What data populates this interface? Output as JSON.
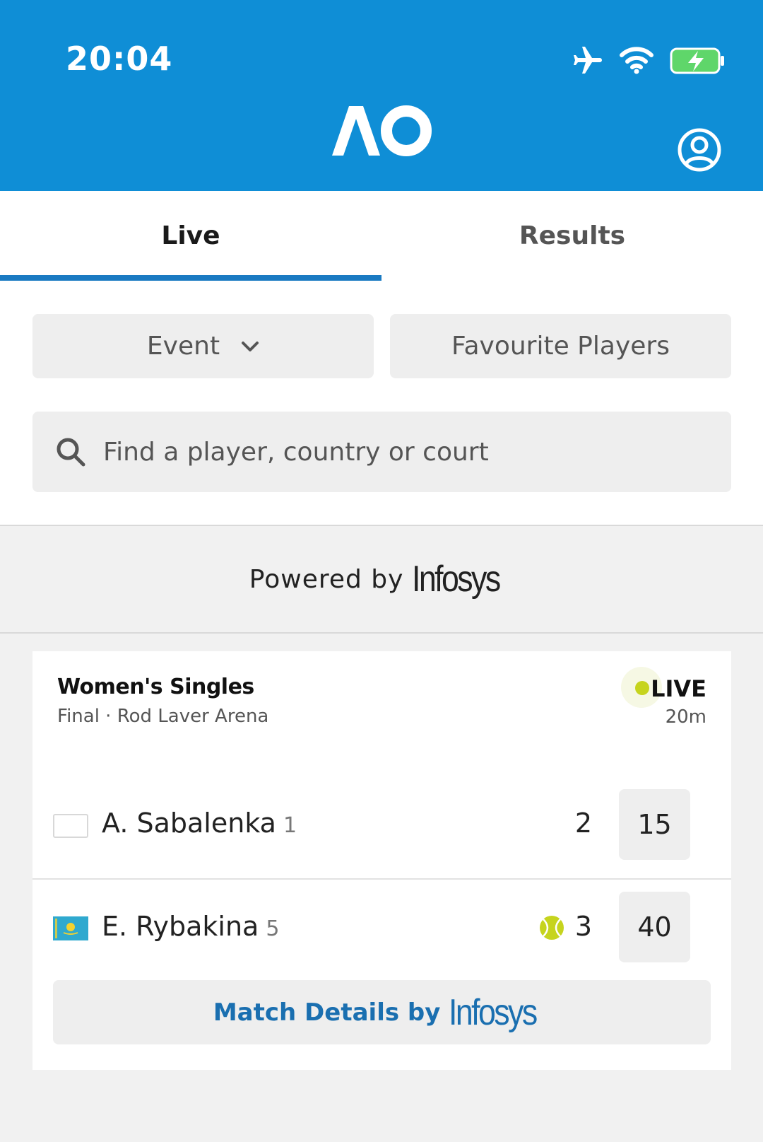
{
  "status_bar": {
    "time": "20:04",
    "icons": [
      "airplane-icon",
      "wifi-icon",
      "battery-charging-icon"
    ]
  },
  "header": {
    "logo_text": "AO",
    "account_icon": "user-circle-icon",
    "background_color": "#0f8ed6"
  },
  "tabs": [
    {
      "label": "Live",
      "active": true
    },
    {
      "label": "Results",
      "active": false
    }
  ],
  "filters": {
    "event_label": "Event",
    "favourites_label": "Favourite Players"
  },
  "search": {
    "placeholder": "Find a player, country or court"
  },
  "sponsor": {
    "powered_by": "Powered by",
    "brand": "Infosys"
  },
  "match": {
    "event": "Women's Singles",
    "subtitle": "Final · Rod Laver Arena",
    "status": "LIVE",
    "duration": "20m",
    "players": [
      {
        "name": "A. Sabalenka",
        "seed": "1",
        "sets": "2",
        "points": "15",
        "serving": false
      },
      {
        "name": "E. Rybakina",
        "seed": "5",
        "sets": "3",
        "points": "40",
        "serving": true
      }
    ],
    "details_label": "Match Details by",
    "details_brand": "Infosys"
  },
  "colors": {
    "accent_blue": "#1a7ac2",
    "live_green": "#c6d41e"
  }
}
